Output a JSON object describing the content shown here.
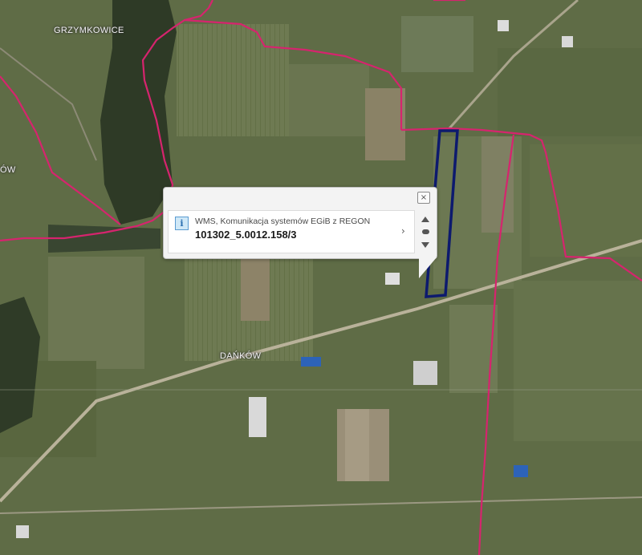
{
  "map": {
    "place_labels": [
      "GRZYMKOWICE",
      "DAŃKÓW",
      "ÓW"
    ],
    "colors": {
      "boundary": "#d6246e",
      "selected_parcel": "#0d1a6e",
      "background": "#5d6a45"
    }
  },
  "popup": {
    "source": "WMS, Komunikacja systemów EGiB z REGON",
    "parcel_id": "101302_5.0012.158/3",
    "close_icon": "close-icon",
    "info_icon": "info-icon",
    "next_icon": "chevron-right-icon",
    "close_glyph": "×",
    "info_glyph": "i",
    "next_glyph": "›"
  }
}
